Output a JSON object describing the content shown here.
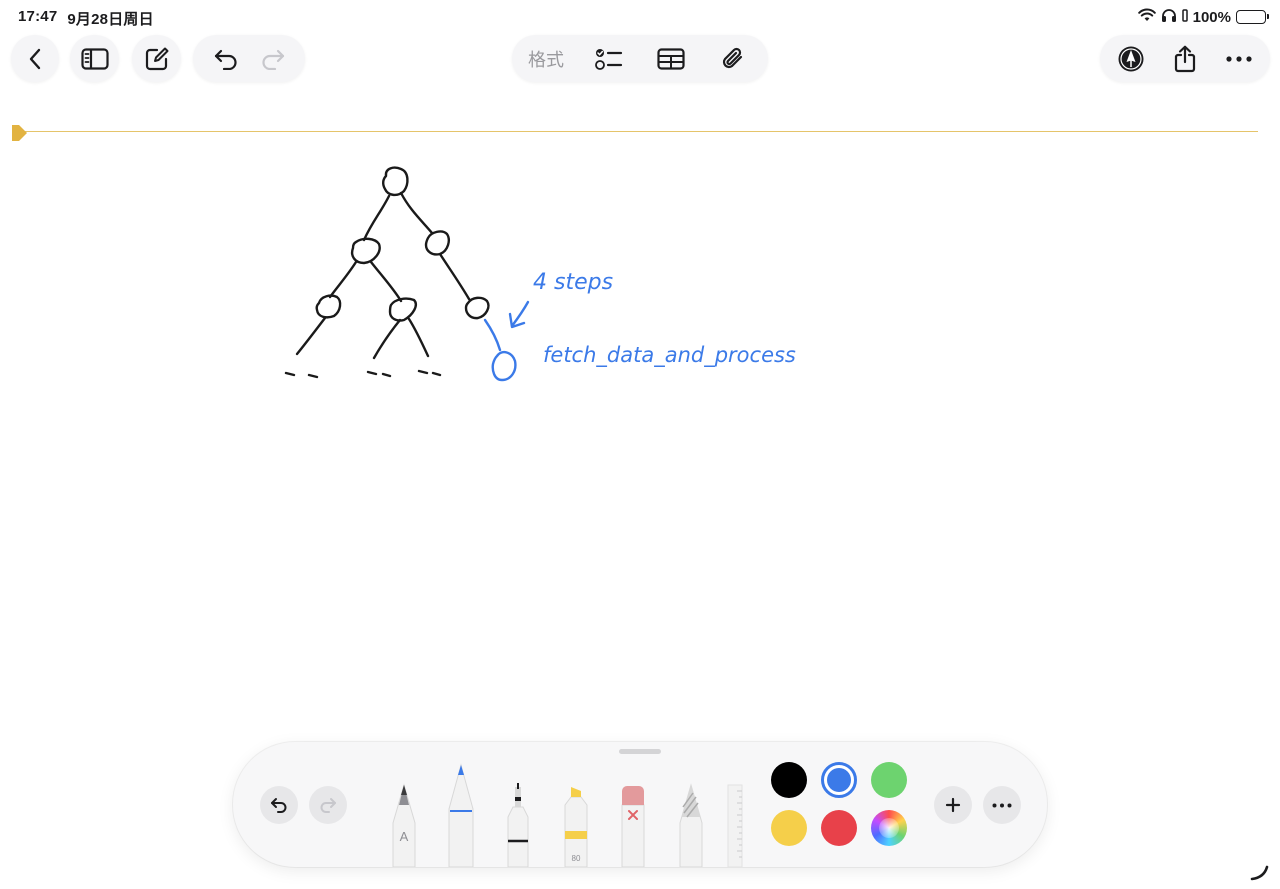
{
  "status_bar": {
    "time": "17:47",
    "date": "9月28日周日",
    "battery": "100%"
  },
  "toolbar": {
    "back_icon": "chevron-left-icon",
    "sidebar_icon": "sidebar-icon",
    "compose_icon": "compose-icon",
    "undo_icon": "undo-icon",
    "redo_icon": "redo-icon",
    "format_label": "格式",
    "checklist_icon": "checklist-icon",
    "table_icon": "table-icon",
    "attachment_icon": "paperclip-icon",
    "markup_icon": "pen-circle-icon",
    "share_icon": "share-icon",
    "more_icon": "ellipsis-icon"
  },
  "canvas": {
    "annotation_steps": "4 steps",
    "annotation_function": "fetch_data_and_process",
    "ink_color": "#1a1a1a",
    "annotation_color": "#3b7ae8"
  },
  "palette": {
    "tools": [
      "monoline-pen",
      "pen",
      "fineliner",
      "highlighter",
      "eraser",
      "pencil",
      "ruler"
    ],
    "highlighter_label": "80",
    "pen_a_label": "A",
    "colors": [
      "#000000",
      "#3b7ae8",
      "#6dd36f",
      "#f5cf4a",
      "#e8414a",
      "rainbow"
    ],
    "selected_color": "#3b7ae8",
    "add_icon": "plus-icon",
    "more_icon": "ellipsis-icon"
  }
}
